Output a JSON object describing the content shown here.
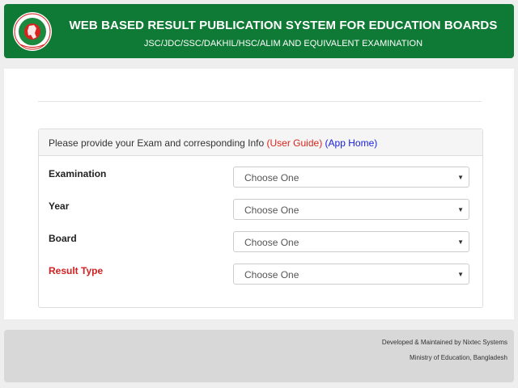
{
  "header": {
    "title": "WEB BASED RESULT PUBLICATION SYSTEM FOR EDUCATION BOARDS",
    "subtitle": "JSC/JDC/SSC/DAKHIL/HSC/ALIM AND EQUIVALENT EXAMINATION",
    "logo_icon": "government-seal-icon",
    "colors": {
      "header_bg": "#0f7a35",
      "seal_green": "#1b8a3e",
      "seal_red": "#d8231f"
    }
  },
  "panel": {
    "heading_prefix": "Please provide your Exam and corresponding Info ",
    "open_paren_1": "(",
    "user_guide_link": "User Guide",
    "close_paren_1": ")",
    "open_paren_2": " (",
    "app_home_link": "App Home",
    "close_paren_2": ")"
  },
  "form": {
    "examination": {
      "label": "Examination",
      "value": "Choose One"
    },
    "year": {
      "label": "Year",
      "value": "Choose One"
    },
    "board": {
      "label": "Board",
      "value": "Choose One"
    },
    "result_type": {
      "label": "Result Type",
      "value": "Choose One"
    },
    "caret_glyph": "▼"
  },
  "footer": {
    "line1": "Developed & Maintained by Nixtec Systems",
    "line2": "Ministry of Education, Bangladesh"
  }
}
